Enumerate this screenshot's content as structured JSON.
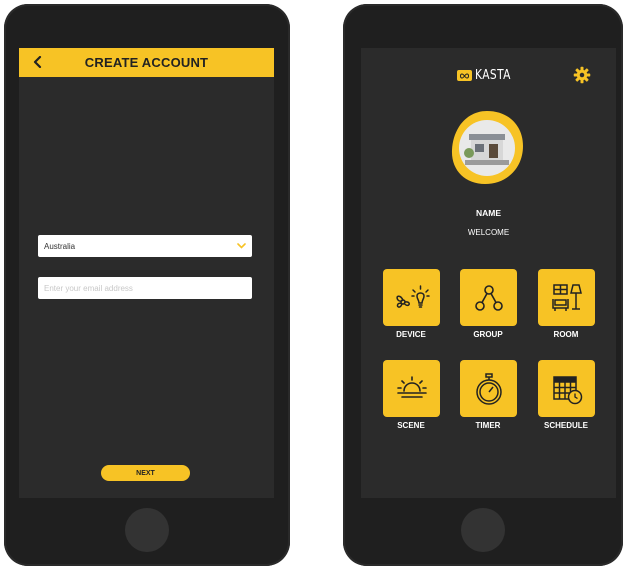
{
  "create_account": {
    "title": "CREATE ACCOUNT",
    "country": {
      "selected": "Australia"
    },
    "email": {
      "placeholder": "Enter your email address",
      "value": ""
    },
    "next_label": "NEXT"
  },
  "home": {
    "brand": "KASTA",
    "profile": {
      "name": "NAME",
      "welcome": "WELCOME"
    },
    "tiles": [
      {
        "label": "DEVICE",
        "icon": "device-icon"
      },
      {
        "label": "GROUP",
        "icon": "group-icon"
      },
      {
        "label": "ROOM",
        "icon": "room-icon"
      },
      {
        "label": "SCENE",
        "icon": "scene-icon"
      },
      {
        "label": "TIMER",
        "icon": "timer-icon"
      },
      {
        "label": "SCHEDULE",
        "icon": "schedule-icon"
      }
    ]
  },
  "colors": {
    "accent": "#f7c325",
    "screen_bg": "#2b2b2b",
    "device_bg": "#1f1f1f"
  }
}
